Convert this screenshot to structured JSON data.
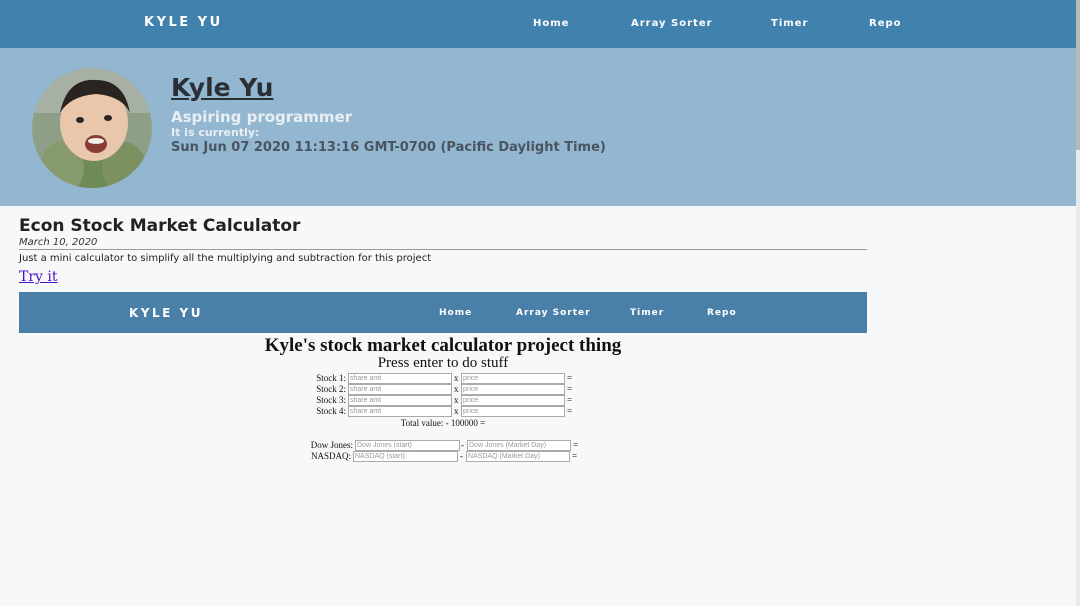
{
  "nav": {
    "brand": "KYLE YU",
    "items": [
      "Home",
      "Array Sorter",
      "Timer",
      "Repo"
    ]
  },
  "hero": {
    "name": "Kyle Yu",
    "tagline": "Aspiring programmer",
    "clock_label": "It is currently:",
    "clock_value": "Sun Jun 07 2020 11:13:16 GMT-0700 (Pacific Daylight Time)"
  },
  "post": {
    "title": "Econ Stock Market Calculator",
    "date": "March 10, 2020",
    "description": "Just a mini calculator to simplify all the multiplying and subtraction for this project",
    "link": "Try it"
  },
  "embed": {
    "nav": {
      "brand": "KYLE YU",
      "items": [
        "Home",
        "Array Sorter",
        "Timer",
        "Repo"
      ]
    },
    "title": "Kyle's stock market calculator project thing",
    "subtitle": "Press enter to do stuff",
    "stocks": [
      {
        "label": "Stock 1:",
        "amt_placeholder": "share amt",
        "price_placeholder": "price",
        "op": "x",
        "eq": "="
      },
      {
        "label": "Stock 2:",
        "amt_placeholder": "share amt",
        "price_placeholder": "price",
        "op": "x",
        "eq": "="
      },
      {
        "label": "Stock 3:",
        "amt_placeholder": "share amt",
        "price_placeholder": "price",
        "op": "x",
        "eq": "="
      },
      {
        "label": "Stock 4:",
        "amt_placeholder": "share amt",
        "price_placeholder": "price",
        "op": "x",
        "eq": "="
      }
    ],
    "total": "Total value: - 100000 =",
    "indices": [
      {
        "label": "Dow Jones:",
        "start_placeholder": "Dow Jones (start)",
        "end_placeholder": "Dow Jones (Market Day)",
        "op": "-",
        "eq": "="
      },
      {
        "label": "NASDAQ:",
        "start_placeholder": "NASDAQ (start)",
        "end_placeholder": "NASDAQ (Market Day)",
        "op": "-",
        "eq": "="
      }
    ]
  },
  "colors": {
    "navbar": "#4181ad",
    "hero": "#93b6d1",
    "link": "#4a12c7"
  }
}
